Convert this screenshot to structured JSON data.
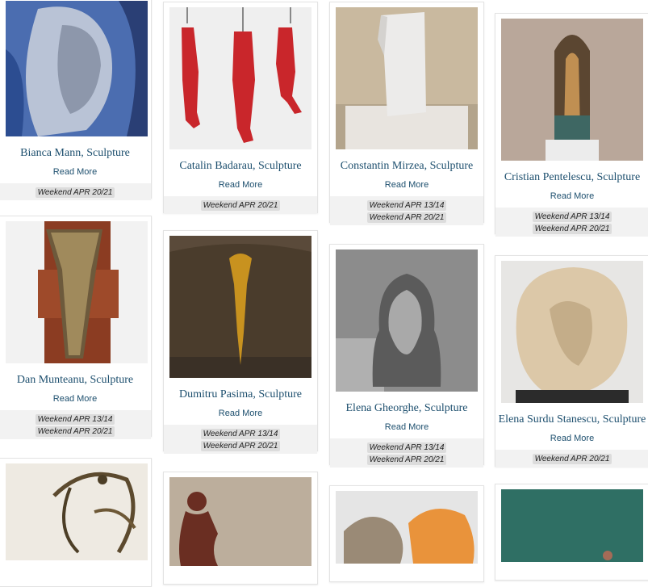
{
  "read_more": "Read More",
  "cards": [
    {
      "title": "Bianca Mann, Sculpture",
      "tags": [
        "Weekend APR 20/21"
      ]
    },
    {
      "title": "Catalin Badarau, Sculpture",
      "tags": [
        "Weekend APR 20/21"
      ]
    },
    {
      "title": "Constantin Mirzea, Sculpture",
      "tags": [
        "Weekend APR 13/14",
        "Weekend APR 20/21"
      ]
    },
    {
      "title": "Cristian Pentelescu, Sculpture",
      "tags": [
        "Weekend APR 13/14",
        "Weekend APR 20/21"
      ]
    },
    {
      "title": "Dan Munteanu, Sculpture",
      "tags": [
        "Weekend APR 13/14",
        "Weekend APR 20/21"
      ]
    },
    {
      "title": "Dumitru Pasima, Sculpture",
      "tags": [
        "Weekend APR 13/14",
        "Weekend APR 20/21"
      ]
    },
    {
      "title": "Elena Gheorghe, Sculpture",
      "tags": [
        "Weekend APR 13/14",
        "Weekend APR 20/21"
      ]
    },
    {
      "title": "Elena Surdu Stanescu, Sculpture",
      "tags": [
        "Weekend APR 20/21"
      ]
    }
  ]
}
